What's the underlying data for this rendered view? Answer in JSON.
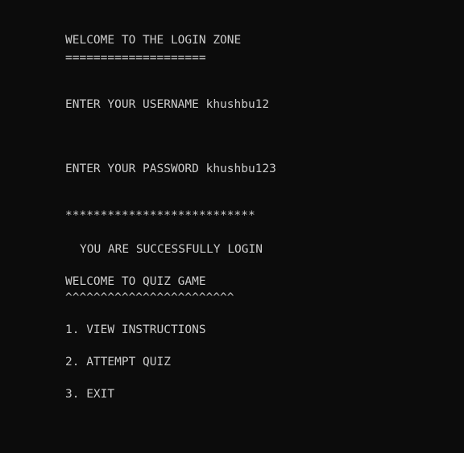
{
  "console": {
    "login_title": "WELCOME TO THE LOGIN ZONE",
    "login_underline": "====================",
    "username_prompt": "ENTER YOUR USERNAME khushbu12",
    "password_prompt": "ENTER YOUR PASSWORD khushbu123",
    "password_mask": "***************************",
    "login_status": "YOU ARE SUCCESSFULLY LOGIN",
    "quiz_title": "WELCOME TO QUIZ GAME",
    "quiz_underline": "^^^^^^^^^^^^^^^^^^^^^^^^",
    "menu": [
      "1. VIEW INSTRUCTIONS",
      "2. ATTEMPT QUIZ",
      "3. EXIT"
    ]
  },
  "colors": {
    "background": "#0c0c0c",
    "text": "#cccccc"
  }
}
